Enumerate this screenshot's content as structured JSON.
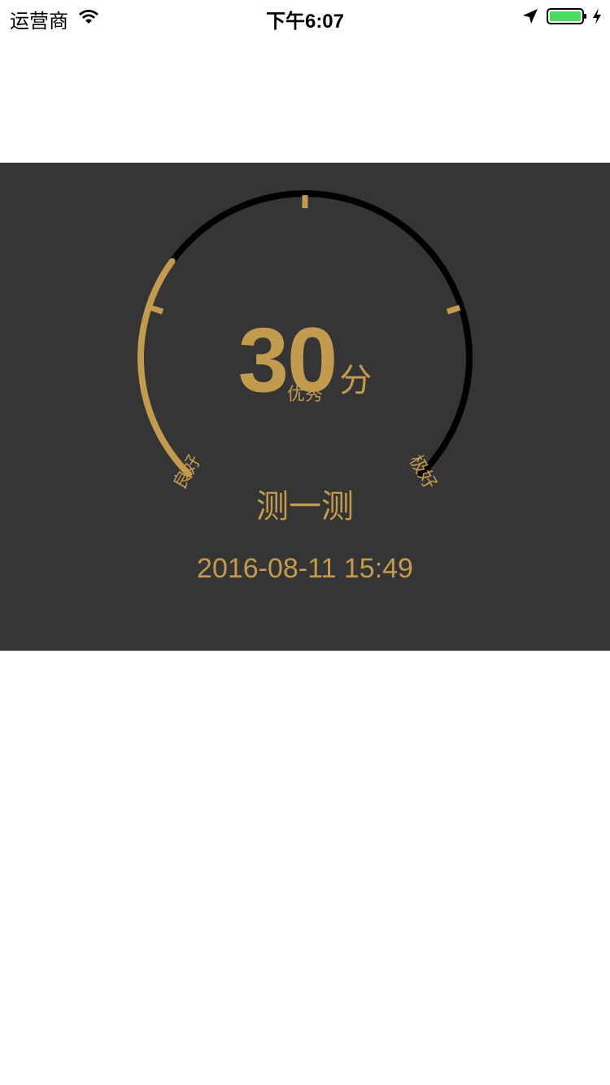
{
  "status_bar": {
    "carrier": "运营商",
    "time": "下午6:07"
  },
  "gauge": {
    "score": "30",
    "unit": "分",
    "level_fraction": 0.3,
    "labels": {
      "good": "良好",
      "excellent": "优秀",
      "superb": "极好"
    }
  },
  "action": {
    "measure_label": "测一测"
  },
  "timestamp": "2016-08-11 15:49",
  "colors": {
    "accent": "#C39B4F",
    "panel_bg": "#353535",
    "track": "#000000",
    "battery": "#4CD964"
  }
}
